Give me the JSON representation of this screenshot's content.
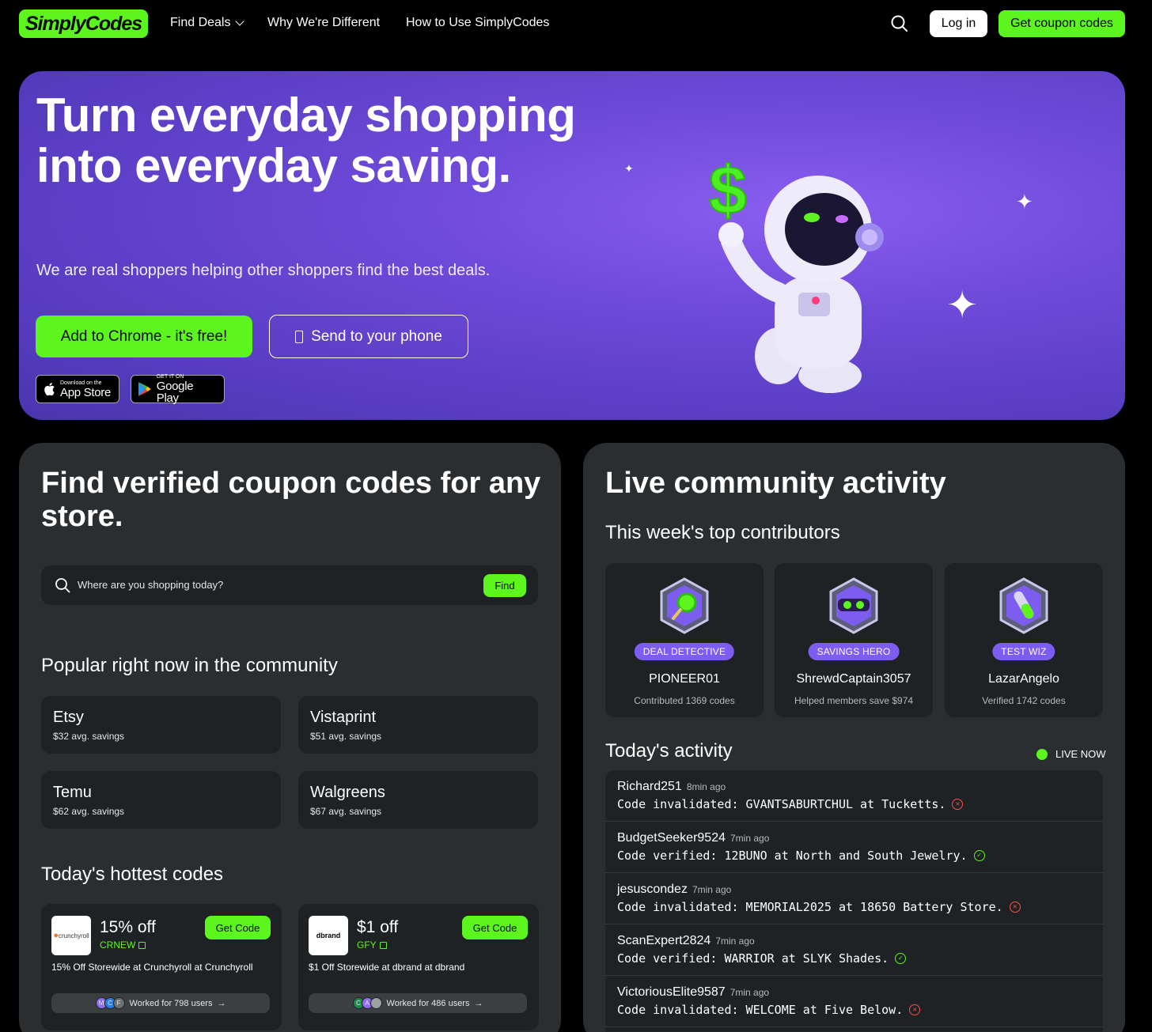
{
  "nav": {
    "logo": "SimplyCodes",
    "links": [
      "Find Deals",
      "Why We're Different",
      "How to Use SimplyCodes"
    ],
    "login": "Log in",
    "cta": "Get coupon codes"
  },
  "hero": {
    "title": "Turn everyday shopping into everyday saving.",
    "subtitle": "We are real shoppers helping other shoppers find the best deals.",
    "chrome_button": "Add to Chrome - it's free!",
    "phone_button": "Send to your phone",
    "app_store": {
      "small": "Download on the",
      "big": "App Store"
    },
    "google_play": {
      "small": "GET IT ON",
      "big": "Google Play"
    }
  },
  "left": {
    "title": "Find verified coupon codes for any store.",
    "search_placeholder": "Where are you shopping today?",
    "find_button": "Find",
    "popular_title": "Popular right now in the community",
    "stores": [
      {
        "name": "Etsy",
        "savings": "$32 avg. savings"
      },
      {
        "name": "Vistaprint",
        "savings": "$51 avg. savings"
      },
      {
        "name": "Temu",
        "savings": "$62 avg. savings"
      },
      {
        "name": "Walgreens",
        "savings": "$67 avg. savings"
      }
    ],
    "hottest_title": "Today's hottest codes",
    "codes": [
      {
        "logo": "crunchyroll",
        "amount": "15% off",
        "code": "CRNEW",
        "button": "Get Code",
        "desc": "15% Off Storewide at Crunchyroll at Crunchyroll",
        "worked": "Worked for 798 users",
        "avatars": [
          "M",
          "C",
          "F"
        ]
      },
      {
        "logo": "dbrand",
        "amount": "$1 off",
        "code": "GFY",
        "button": "Get Code",
        "desc": "$1 Off Storewide at dbrand at dbrand",
        "worked": "Worked for 486 users",
        "avatars": [
          "C",
          "A",
          ""
        ]
      }
    ]
  },
  "right": {
    "title": "Live community activity",
    "contrib_title": "This week's top contributors",
    "contributors": [
      {
        "badge": "DEAL DETECTIVE",
        "name": "PIONEER01",
        "stat": "Contributed 1369 codes",
        "icon": "magnifier-icon"
      },
      {
        "badge": "SAVINGS HERO",
        "name": "ShrewdCaptain3057",
        "stat": "Helped members save $974",
        "icon": "mask-icon"
      },
      {
        "badge": "TEST WIZ",
        "name": "LazarAngelo",
        "stat": "Verified 1742 codes",
        "icon": "test-tube-icon"
      }
    ],
    "activity_title": "Today's activity",
    "live_label": "LIVE NOW",
    "activity": [
      {
        "user": "Richard251",
        "time": "8min ago",
        "msg": "Code invalidated: GVANTSABURTCHUL at Tucketts.",
        "status": "invalid"
      },
      {
        "user": "BudgetSeeker9524",
        "time": "7min ago",
        "msg": "Code verified: 12BUNO at North and South Jewelry.",
        "status": "verified"
      },
      {
        "user": "jesuscondez",
        "time": "7min ago",
        "msg": "Code invalidated: MEMORIAL2025 at 18650 Battery Store.",
        "status": "invalid"
      },
      {
        "user": "ScanExpert2824",
        "time": "7min ago",
        "msg": "Code verified: WARRIOR at SLYK Shades.",
        "status": "verified"
      },
      {
        "user": "VictoriousElite9587",
        "time": "7min ago",
        "msg": "Code invalidated: WELCOME at Five Below.",
        "status": "invalid"
      }
    ]
  },
  "colors": {
    "accent": "#5cf51d",
    "card": "#2b2e30",
    "tile": "#1f2224",
    "badge": "#7c5df0",
    "invalid": "#ff4d4d"
  }
}
